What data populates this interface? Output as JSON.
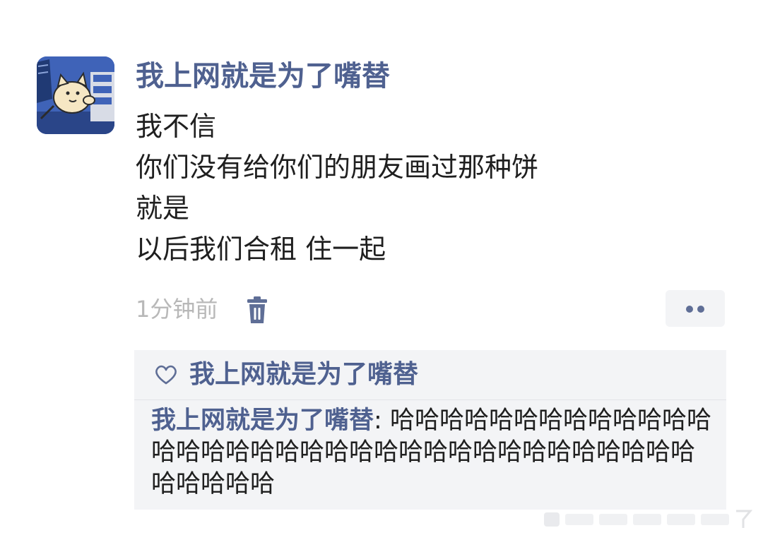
{
  "post": {
    "author": "我上网就是为了嘴替",
    "lines": [
      "我不信",
      "你们没有给你们的朋友画过那种饼",
      "就是",
      "以后我们合租 住一起"
    ],
    "timestamp": "1分钟前"
  },
  "icons": {
    "avatar": "cartoon-cat-avatar",
    "delete": "trash-icon",
    "more": "more-dots-icon",
    "like": "heart-outline-icon"
  },
  "reply_box": {
    "liker": "我上网就是为了嘴替",
    "comment_author": "我上网就是为了嘴替",
    "comment_separator": ": ",
    "comment_text": "哈哈哈哈哈哈哈哈哈哈哈哈哈哈哈哈哈哈哈哈哈哈哈哈哈哈哈哈哈哈哈哈哈哈哈哈哈哈哈哈"
  },
  "colors": {
    "name_blue": "#4f6190",
    "icon_blue": "#5f6e96",
    "text": "#1f1f1f",
    "timestamp_gray": "#b8b8b8",
    "reply_bg": "#f3f4f6"
  }
}
